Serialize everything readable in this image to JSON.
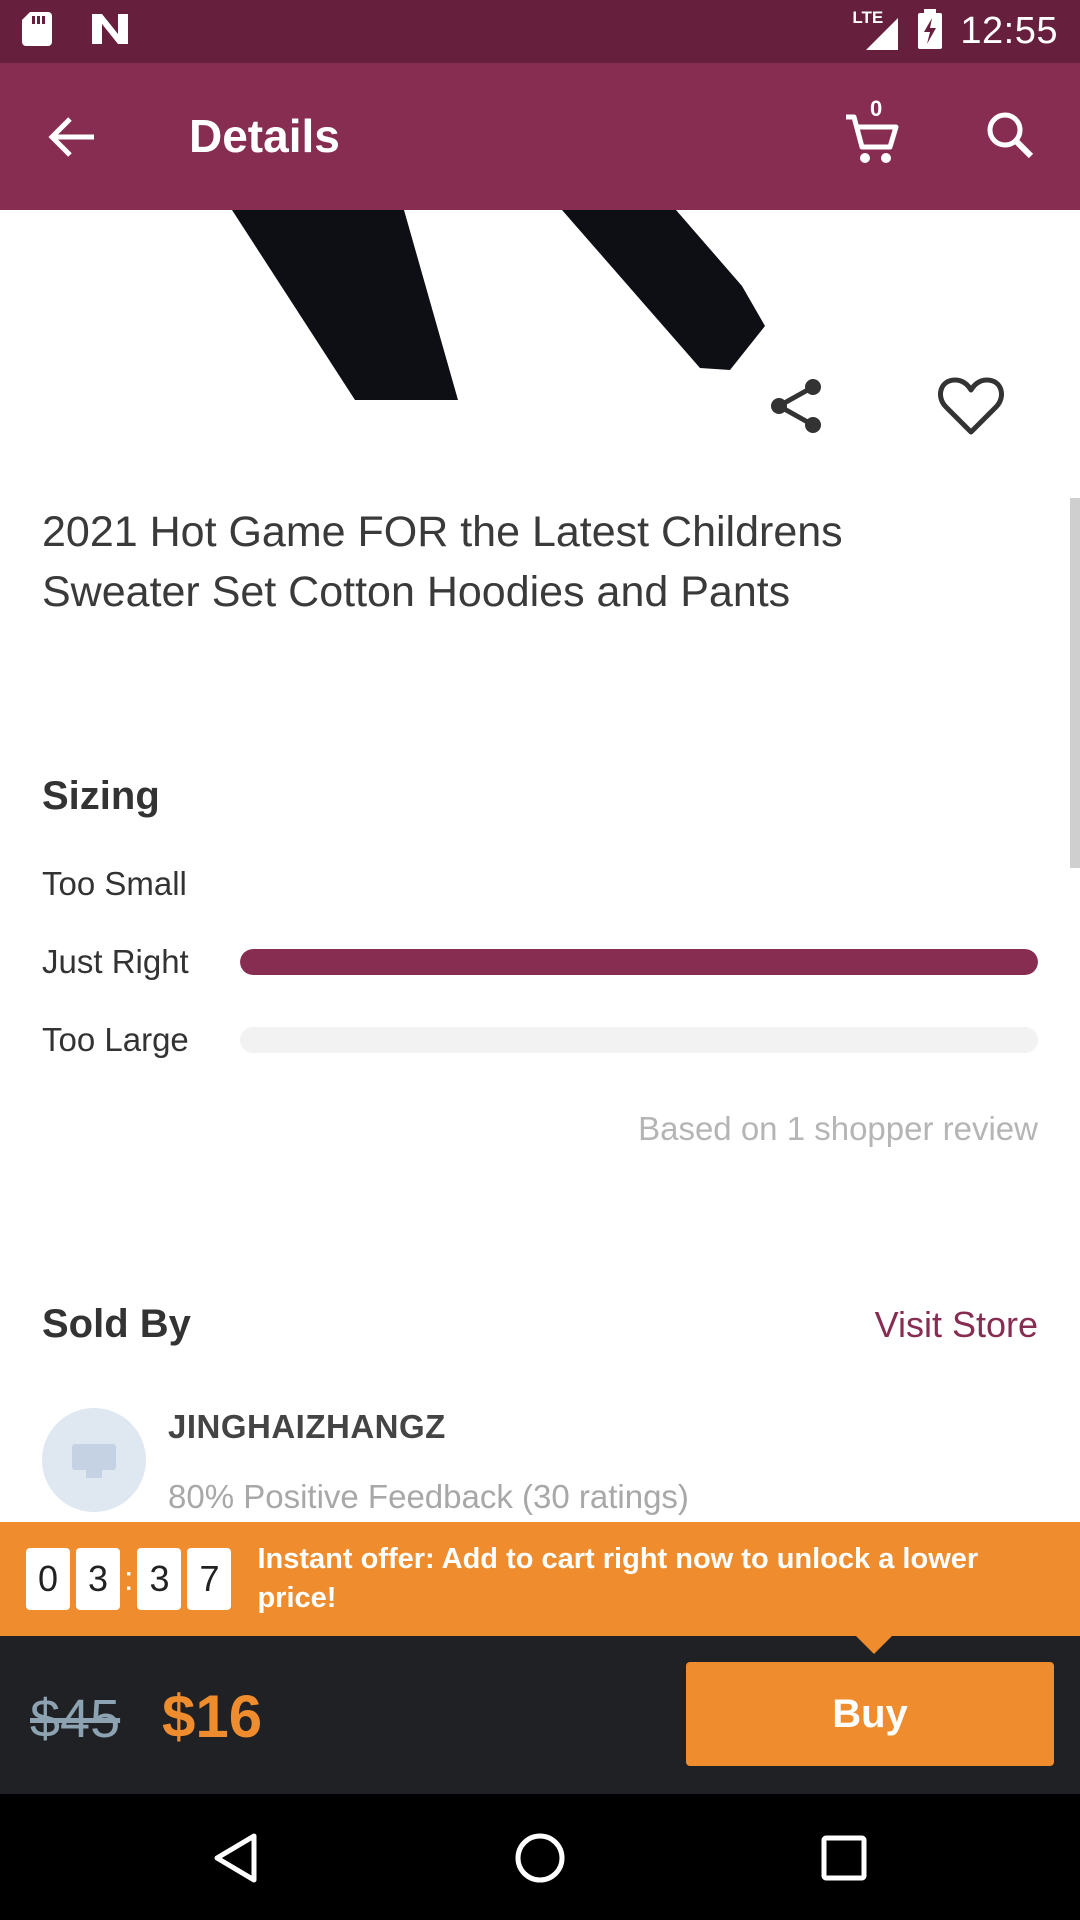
{
  "status_bar": {
    "time": "12:55",
    "network": "LTE",
    "icons": [
      "sd-card-icon",
      "notification-n-icon",
      "signal-icon",
      "battery-charging-icon"
    ]
  },
  "app_bar": {
    "title": "Details",
    "cart_count": "0",
    "icons": [
      "back-arrow-icon",
      "cart-icon",
      "search-icon"
    ]
  },
  "product": {
    "title": "2021 Hot Game FOR the Latest Childrens Sweater Set Cotton Hoodies and Pants",
    "actions": [
      "share-icon",
      "heart-icon"
    ]
  },
  "sizing": {
    "title": "Sizing",
    "rows": [
      {
        "label": "Too Small",
        "fraction": 0
      },
      {
        "label": "Just Right",
        "fraction": 1
      },
      {
        "label": "Too Large",
        "fraction": 0
      }
    ],
    "note": "Based on 1 shopper review"
  },
  "sold_by": {
    "title": "Sold By",
    "visit_store": "Visit Store",
    "store_name": "JINGHAIZHANGZ",
    "feedback": "80% Positive Feedback (30 ratings)"
  },
  "offer": {
    "timer": [
      "0",
      "3",
      "3",
      "7"
    ],
    "separator": ":",
    "text": "Instant offer: Add to cart right now to unlock a lower price!"
  },
  "purchase": {
    "old_price": "$45",
    "new_price": "$16",
    "buy_label": "Buy"
  },
  "colors": {
    "status_bar": "#661f3c",
    "app_bar": "#872d52",
    "accent_orange": "#ef8d2e",
    "bottom_bar": "#1f2124"
  }
}
